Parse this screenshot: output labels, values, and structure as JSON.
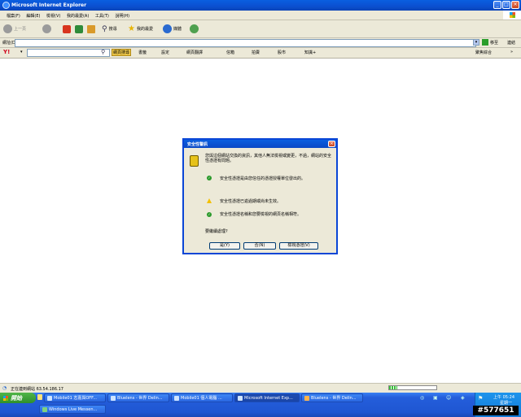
{
  "window": {
    "title": "Microsoft Internet Explorer"
  },
  "menu": [
    "檔案(F)",
    "編輯(E)",
    "檢視(V)",
    "我的最愛(A)",
    "工具(T)",
    "說明(H)"
  ],
  "toolbar": {
    "back": "上一頁",
    "search": "搜尋",
    "favorites": "我的最愛",
    "media": "媒體"
  },
  "address": {
    "label": "網址(D)",
    "go": "移至",
    "links": "連結"
  },
  "yahoo": {
    "logo": "Y!",
    "web_search": "網頁搜尋",
    "bookmarks": "書籤",
    "settings": "設定",
    "translate": "網頁翻譯",
    "mail": "信箱",
    "auction": "拍賣",
    "finance": "股市",
    "knowledge": "知識+",
    "personal": "聚焦綜合"
  },
  "dialog": {
    "title": "安全性警訊",
    "intro": "您與這個網站交換的資訊，其他人無法檢視或變更，不過，網站的安全性憑證有問題。",
    "items": [
      {
        "icon": "check-icon",
        "text": "安全性憑證是由您信任的憑證授權單位發出的。"
      },
      {
        "icon": "warning-icon",
        "text": "安全性憑證已逾過期或尚未生效。"
      },
      {
        "icon": "check-icon",
        "text": "安全性憑證名稱和您要檢視的網頁名稱相符。"
      }
    ],
    "question": "要繼續處理?",
    "buttons": {
      "yes": "是(Y)",
      "no": "否(N)",
      "view": "檢視憑證(V)"
    }
  },
  "status": {
    "text": "正在連到網站 63.54.186.17"
  },
  "taskbar": {
    "start": "開始",
    "tasks": [
      {
        "label": "Mobile01 志嘉與OFF...",
        "active": false
      },
      {
        "label": "Bluelens - 世界 Delin...",
        "active": false
      },
      {
        "label": "Mobile01 個人電腦 ...",
        "active": false
      },
      {
        "label": "Microsoft Internet Exp...",
        "active": true
      },
      {
        "label": "Bluelens - 世界 Delin...",
        "active": false
      },
      {
        "label": "Windows Live Messen...",
        "active": false
      }
    ],
    "clock": "上午 05:24",
    "day": "星期一"
  },
  "watermark": "#577651",
  "colors": {
    "xp_blue": "#0a46d6",
    "face": "#ece9d8",
    "start_green": "#3a9e35"
  }
}
